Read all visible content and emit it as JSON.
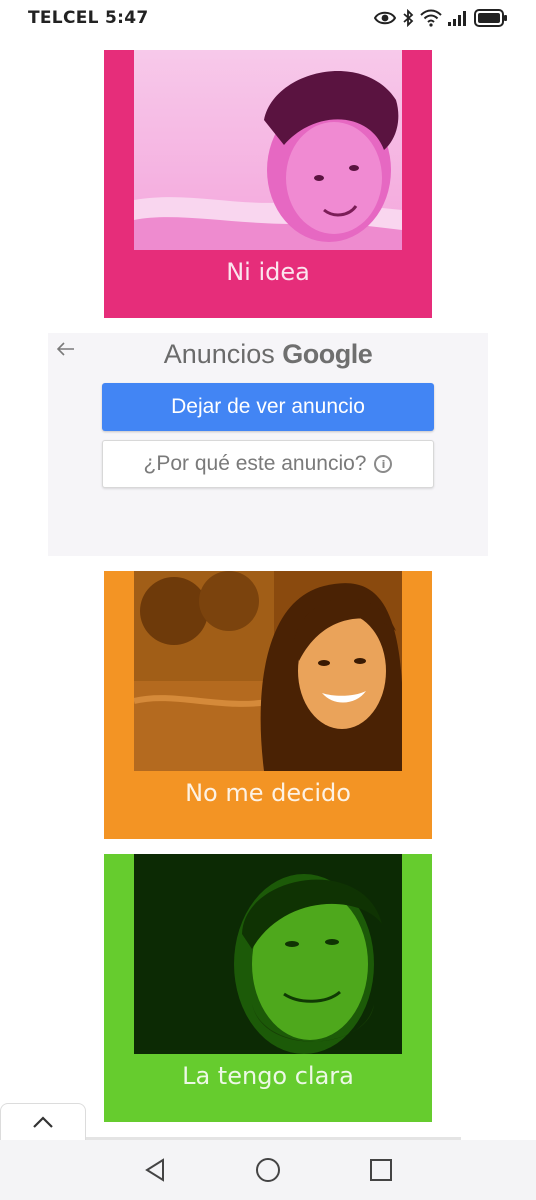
{
  "status_bar": {
    "carrier_time": "TELCEL 5:47",
    "icons": [
      "eye-icon",
      "bluetooth-icon",
      "wifi-icon",
      "signal-icon",
      "battery-icon"
    ]
  },
  "cards": [
    {
      "caption": "Ni idea",
      "color": "#e62d7a",
      "photo": "young man with dark hair, pink tint"
    },
    {
      "caption": "No me decido",
      "color": "#f39424",
      "photo": "smiling woman outdoors, orange tint"
    },
    {
      "caption": "La tengo clara",
      "color": "#66cc2e",
      "photo": "smiling man, green tint"
    }
  ],
  "ad": {
    "title_prefix": "Anuncios",
    "title_brand": "Google",
    "stop_button": "Dejar de ver anuncio",
    "why_button": "¿Por qué este anuncio?",
    "accent": "#4285f4"
  },
  "nav": {
    "back": "back-icon",
    "home": "home-icon",
    "recents": "recents-icon"
  }
}
